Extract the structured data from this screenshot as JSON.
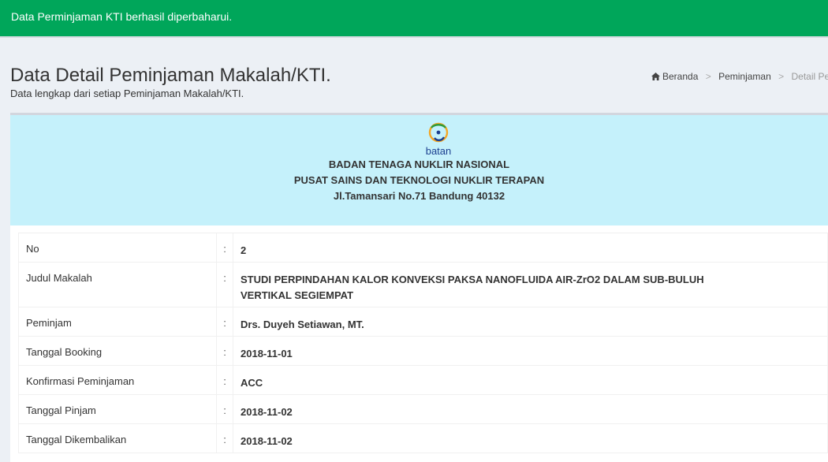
{
  "alert": {
    "message": "Data Perminjaman KTI berhasil diperbaharui."
  },
  "header": {
    "title": "Data Detail Peminjaman Makalah/KTI.",
    "subtitle": "Data lengkap dari setiap Peminjaman Makalah/KTI."
  },
  "breadcrumb": {
    "home_icon": "home-icon",
    "items": [
      "Beranda",
      "Peminjaman",
      "Detail Pe"
    ],
    "separator": ">"
  },
  "org": {
    "logo_text": "batan",
    "line1": "BADAN TENAGA NUKLIR NASIONAL",
    "line2": "PUSAT SAINS DAN TEKNOLOGI NUKLIR TERAPAN",
    "line3": "Jl.Tamansari No.71 Bandung 40132"
  },
  "details": {
    "separator": ":",
    "rows": [
      {
        "label": "No",
        "value": "2"
      },
      {
        "label": "Judul Makalah",
        "value": "STUDI PERPINDAHAN KALOR KONVEKSI PAKSA NANOFLUIDA AIR-ZrO2 DALAM SUB-BULUH VERTIKAL SEGIEMPAT"
      },
      {
        "label": "Peminjam",
        "value": "Drs. Duyeh Setiawan, MT."
      },
      {
        "label": "Tanggal Booking",
        "value": "2018-11-01"
      },
      {
        "label": "Konfirmasi Peminjaman",
        "value": "ACC"
      },
      {
        "label": "Tanggal Pinjam",
        "value": "2018-11-02"
      },
      {
        "label": "Tanggal Dikembalikan",
        "value": "2018-11-02"
      }
    ]
  },
  "colors": {
    "alert_bg": "#00a65a",
    "org_header_bg": "#c5f1fb",
    "page_bg": "#ecf0f5"
  }
}
